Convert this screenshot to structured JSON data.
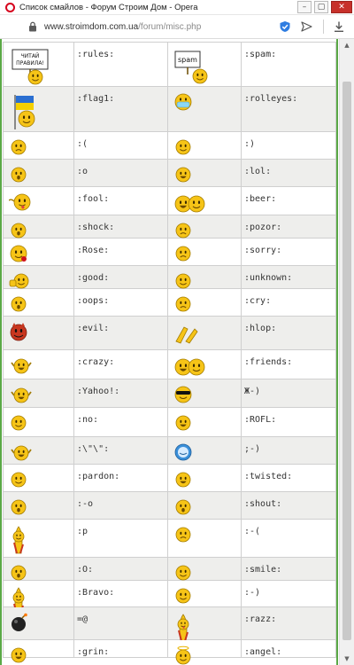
{
  "window": {
    "title": "Список смайлов - Форум Строим Дом - Opera",
    "minimize": "–",
    "maximize": "▢",
    "close": "✕"
  },
  "address_bar": {
    "host": "www.stroimdom.com.ua",
    "path": "/forum/misc.php"
  },
  "colors": {
    "page_border": "#5aa846",
    "row_alt": "#eeeeec",
    "smiley_yellow": "#f6c417",
    "smiley_outline": "#a27b00"
  },
  "smilies": {
    "rows": [
      {
        "left": {
          "code": ":rules:",
          "icon": "rules-sign-smiley-icon",
          "sign": "ЧИТАЙ ПРАВИЛА!"
        },
        "right": {
          "code": ":spam:",
          "icon": "spam-sign-smiley-icon",
          "sign": "spam"
        }
      },
      {
        "left": {
          "code": ":flag1:",
          "icon": "flag-smiley-icon"
        },
        "right": {
          "code": ":rolleyes:",
          "icon": "rolleyes-smiley-icon"
        }
      },
      {
        "left": {
          "code": ":(",
          "icon": "sad-smiley-icon"
        },
        "right": {
          "code": ":)",
          "icon": "smile-smiley-icon"
        }
      },
      {
        "left": {
          "code": ":o",
          "icon": "surprised-smiley-icon"
        },
        "right": {
          "code": ":lol:",
          "icon": "lol-smiley-icon"
        }
      },
      {
        "left": {
          "code": ":fool:",
          "icon": "fool-smiley-icon"
        },
        "right": {
          "code": ":beer:",
          "icon": "beer-smiley-icon"
        }
      },
      {
        "left": {
          "code": ":shock:",
          "icon": "shock-smiley-icon"
        },
        "right": {
          "code": ":pozor:",
          "icon": "pozor-smiley-icon"
        }
      },
      {
        "left": {
          "code": ":Rose:",
          "icon": "rose-smiley-icon"
        },
        "right": {
          "code": ":sorry:",
          "icon": "sorry-smiley-icon"
        }
      },
      {
        "left": {
          "code": ":good:",
          "icon": "good-smiley-icon"
        },
        "right": {
          "code": ":unknown:",
          "icon": "unknown-smiley-icon"
        }
      },
      {
        "left": {
          "code": ":oops:",
          "icon": "oops-smiley-icon"
        },
        "right": {
          "code": ":cry:",
          "icon": "cry-smiley-icon"
        }
      },
      {
        "left": {
          "code": ":evil:",
          "icon": "evil-smiley-icon"
        },
        "right": {
          "code": ":hlop:",
          "icon": "clap-smiley-icon"
        }
      },
      {
        "left": {
          "code": ":crazy:",
          "icon": "crazy-smiley-icon"
        },
        "right": {
          "code": ":friends:",
          "icon": "friends-smiley-icon"
        }
      },
      {
        "left": {
          "code": ":Yahoo!:",
          "icon": "yahoo-smiley-icon"
        },
        "right": {
          "code": "Ж-)",
          "icon": "sunglasses-smiley-icon"
        }
      },
      {
        "left": {
          "code": ":no:",
          "icon": "no-smiley-icon"
        },
        "right": {
          "code": ":ROFL:",
          "icon": "rofl-smiley-icon"
        }
      },
      {
        "left": {
          "code": ":\\\"\\\":",
          "icon": "dance-smiley-icon"
        },
        "right": {
          "code": ";-)",
          "icon": "wink-smiley-icon"
        }
      },
      {
        "left": {
          "code": ":pardon:",
          "icon": "pardon-smiley-icon"
        },
        "right": {
          "code": ":twisted:",
          "icon": "twisted-smiley-icon"
        }
      },
      {
        "left": {
          "code": ":-o",
          "icon": "surprised-smiley-icon"
        },
        "right": {
          "code": ":shout:",
          "icon": "shout-smiley-icon"
        }
      },
      {
        "left": {
          "code": ":p",
          "icon": "tongue-smiley-icon"
        },
        "right": {
          "code": ":-(",
          "icon": "sad-smiley-icon"
        }
      },
      {
        "left": {
          "code": ":O:",
          "icon": "big-o-smiley-icon"
        },
        "right": {
          "code": ":smile:",
          "icon": "smile-smiley-icon"
        }
      },
      {
        "left": {
          "code": ":Bravo:",
          "icon": "bravo-smiley-icon"
        },
        "right": {
          "code": ":-)",
          "icon": "smile-smiley-icon"
        }
      },
      {
        "left": {
          "code": "=@",
          "icon": "bomb-icon"
        },
        "right": {
          "code": ":razz:",
          "icon": "razz-smiley-icon"
        }
      },
      {
        "left": {
          "code": ":grin:",
          "icon": "grin-smiley-icon"
        },
        "right": {
          "code": ":angel:",
          "icon": "angel-smiley-icon"
        }
      }
    ]
  }
}
